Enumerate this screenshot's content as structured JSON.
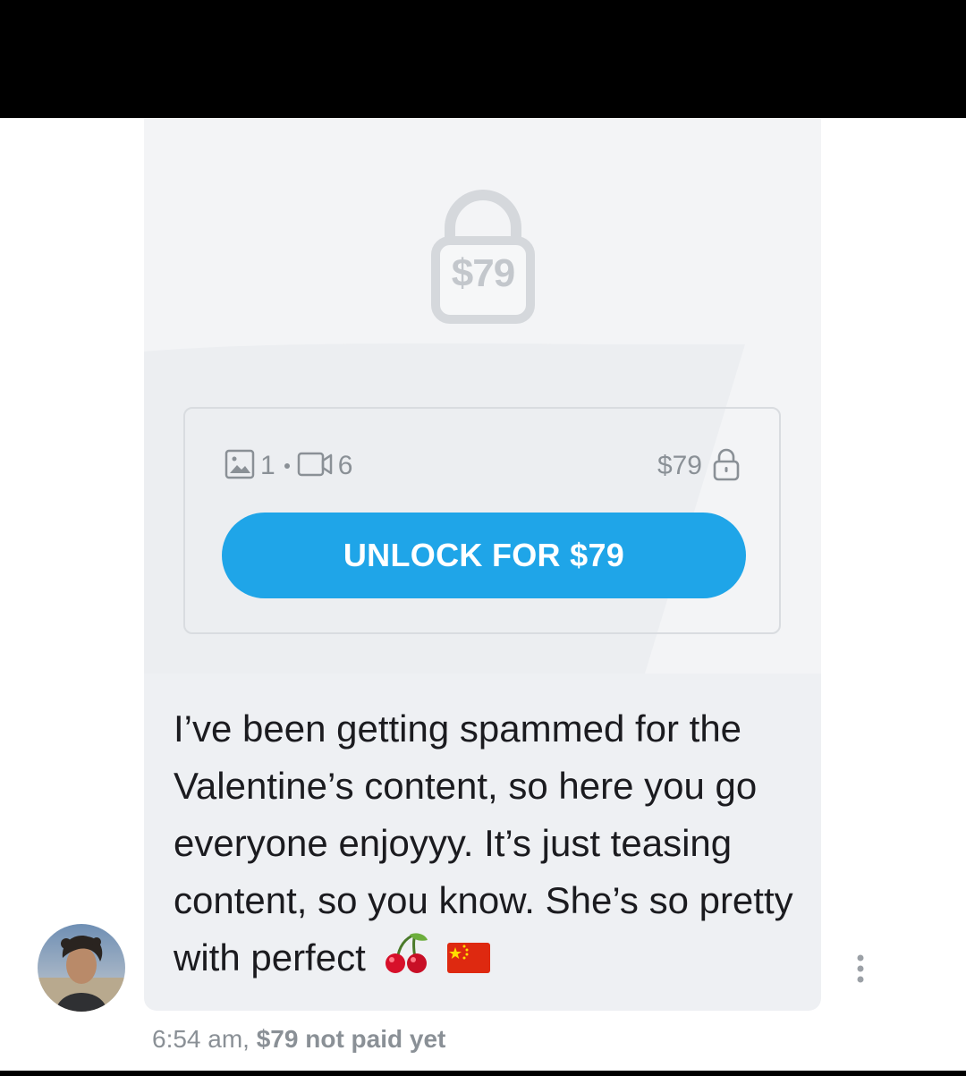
{
  "locked_post": {
    "lock_price": "$79",
    "photo_count": "1",
    "video_count": "6",
    "price": "$79",
    "unlock_button_label": "UNLOCK FOR $79"
  },
  "message": {
    "text": "I’ve been getting spammed for the Valentine’s content, so here you go everyone enjoyyy. It’s just teasing content, so you know. She’s so pretty with perfect",
    "emojis": [
      "cherries-emoji",
      "china-flag-emoji"
    ]
  },
  "footer": {
    "time": "6:54 am,",
    "payment_status": "$79 not paid yet"
  },
  "colors": {
    "accent": "#1fa5e8",
    "muted_text": "#8a9096",
    "bubble_bg": "#eef0f3"
  }
}
